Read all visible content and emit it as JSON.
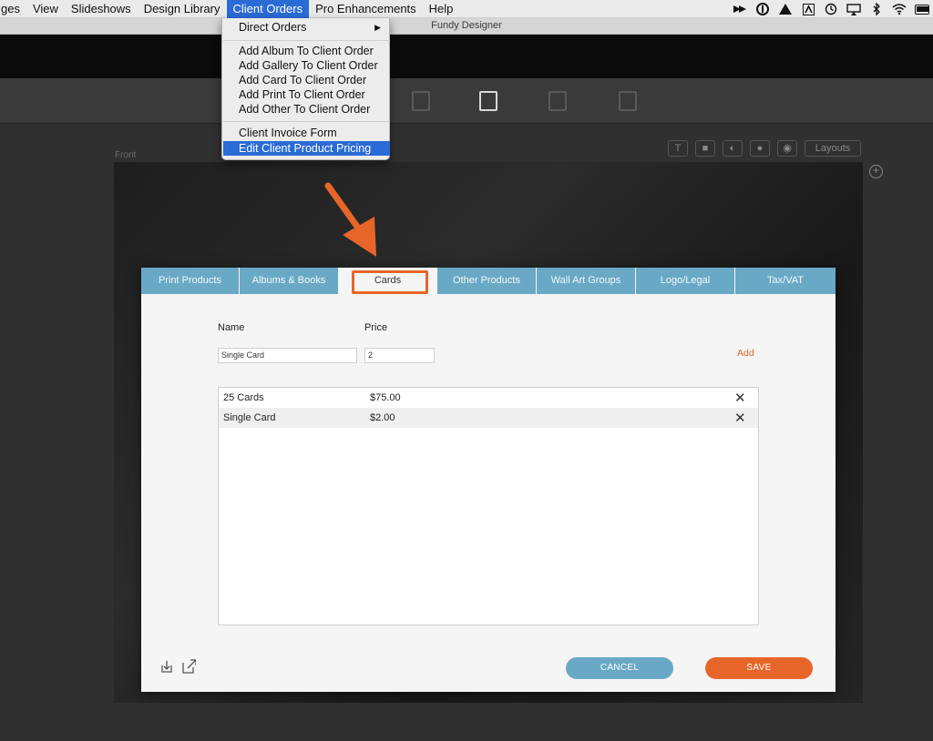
{
  "menubar": {
    "items": [
      {
        "label": "ges"
      },
      {
        "label": "View"
      },
      {
        "label": "Slideshows"
      },
      {
        "label": "Design Library"
      },
      {
        "label": "Client Orders",
        "active": true
      },
      {
        "label": "Pro Enhancements"
      },
      {
        "label": "Help"
      }
    ],
    "status_icons": [
      "arrow-icon",
      "info-icon",
      "drive-icon",
      "app-icon",
      "time-machine-icon",
      "airplay-icon",
      "bluetooth-icon",
      "wifi-icon",
      "battery-icon"
    ]
  },
  "window": {
    "title": "Fundy Designer"
  },
  "dropdown": {
    "items": [
      {
        "label": "Direct Orders",
        "submenu": true
      },
      {
        "label": "Add Album To Client Order"
      },
      {
        "label": "Add Gallery To Client Order"
      },
      {
        "label": "Add Card To Client Order"
      },
      {
        "label": "Add Print To Client Order"
      },
      {
        "label": "Add Other To Client Order"
      },
      {
        "label": "Client Invoice Form"
      },
      {
        "label": "Edit Client Product Pricing",
        "highlighted": true
      }
    ],
    "submenu_arrow": "▶"
  },
  "canvas": {
    "front_label": "Front",
    "layouts_label": "Layouts"
  },
  "dialog": {
    "tabs": [
      {
        "label": "Print Products"
      },
      {
        "label": "Albums & Books"
      },
      {
        "label": "Cards",
        "active": true
      },
      {
        "label": "Other Products"
      },
      {
        "label": "Wall Art Groups"
      },
      {
        "label": "Logo/Legal"
      },
      {
        "label": "Tax/VAT"
      }
    ],
    "form": {
      "name_label": "Name",
      "price_label": "Price",
      "name_value": "Single Card",
      "price_value": "2",
      "add_label": "Add"
    },
    "rows": [
      {
        "name": "25 Cards",
        "price": "$75.00"
      },
      {
        "name": "Single Card",
        "price": "$2.00"
      }
    ],
    "delete_glyph": "✕",
    "buttons": {
      "cancel": "CANCEL",
      "save": "SAVE"
    }
  },
  "colors": {
    "accent": "#e8652a",
    "tab_blue": "#6aa9c5",
    "menu_highlight": "#2a6bd6"
  }
}
